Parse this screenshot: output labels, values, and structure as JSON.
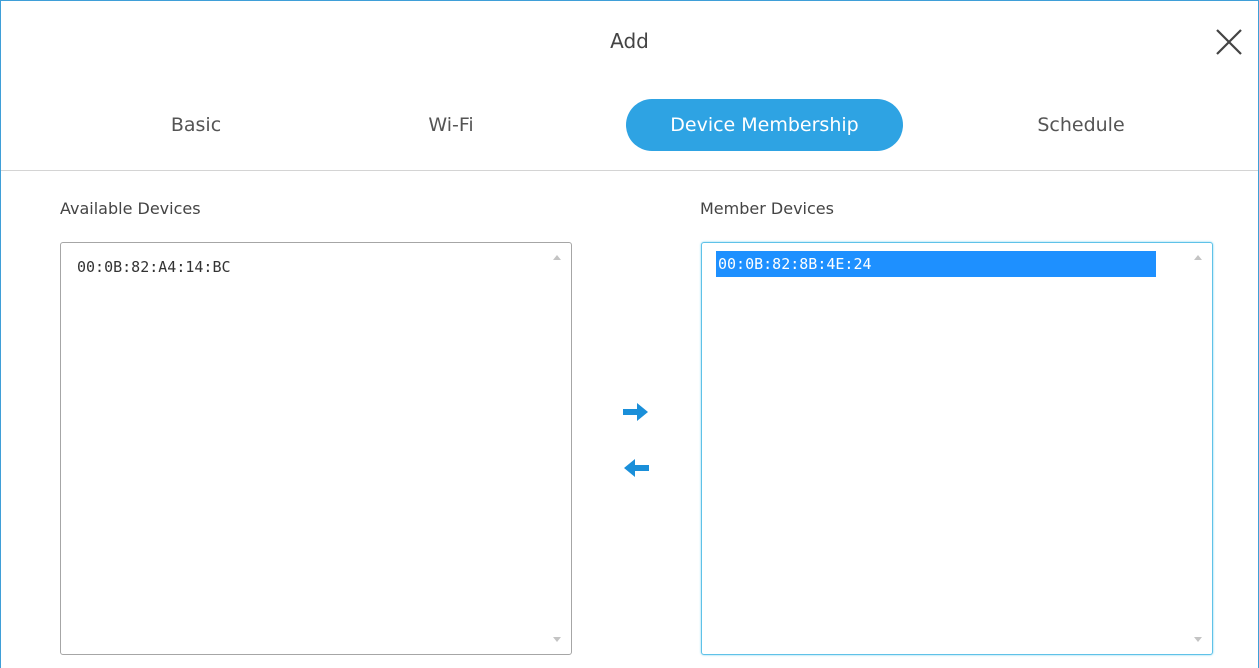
{
  "dialog": {
    "title": "Add",
    "close_icon": "close-icon"
  },
  "tabs": [
    {
      "label": "Basic",
      "active": false
    },
    {
      "label": "Wi-Fi",
      "active": false
    },
    {
      "label": "Device Membership",
      "active": true
    },
    {
      "label": "Schedule",
      "active": false
    }
  ],
  "available": {
    "label": "Available Devices",
    "items": [
      "00:0B:82:A4:14:BC"
    ]
  },
  "member": {
    "label": "Member Devices",
    "items": [
      "00:0B:82:8B:4E:24"
    ],
    "selected_index": 0
  },
  "transfer": {
    "add_icon": "arrow-right-icon",
    "remove_icon": "arrow-left-icon"
  },
  "colors": {
    "accent": "#2ea3e3",
    "selection": "#1e90ff",
    "border": "#3f9fd8"
  }
}
